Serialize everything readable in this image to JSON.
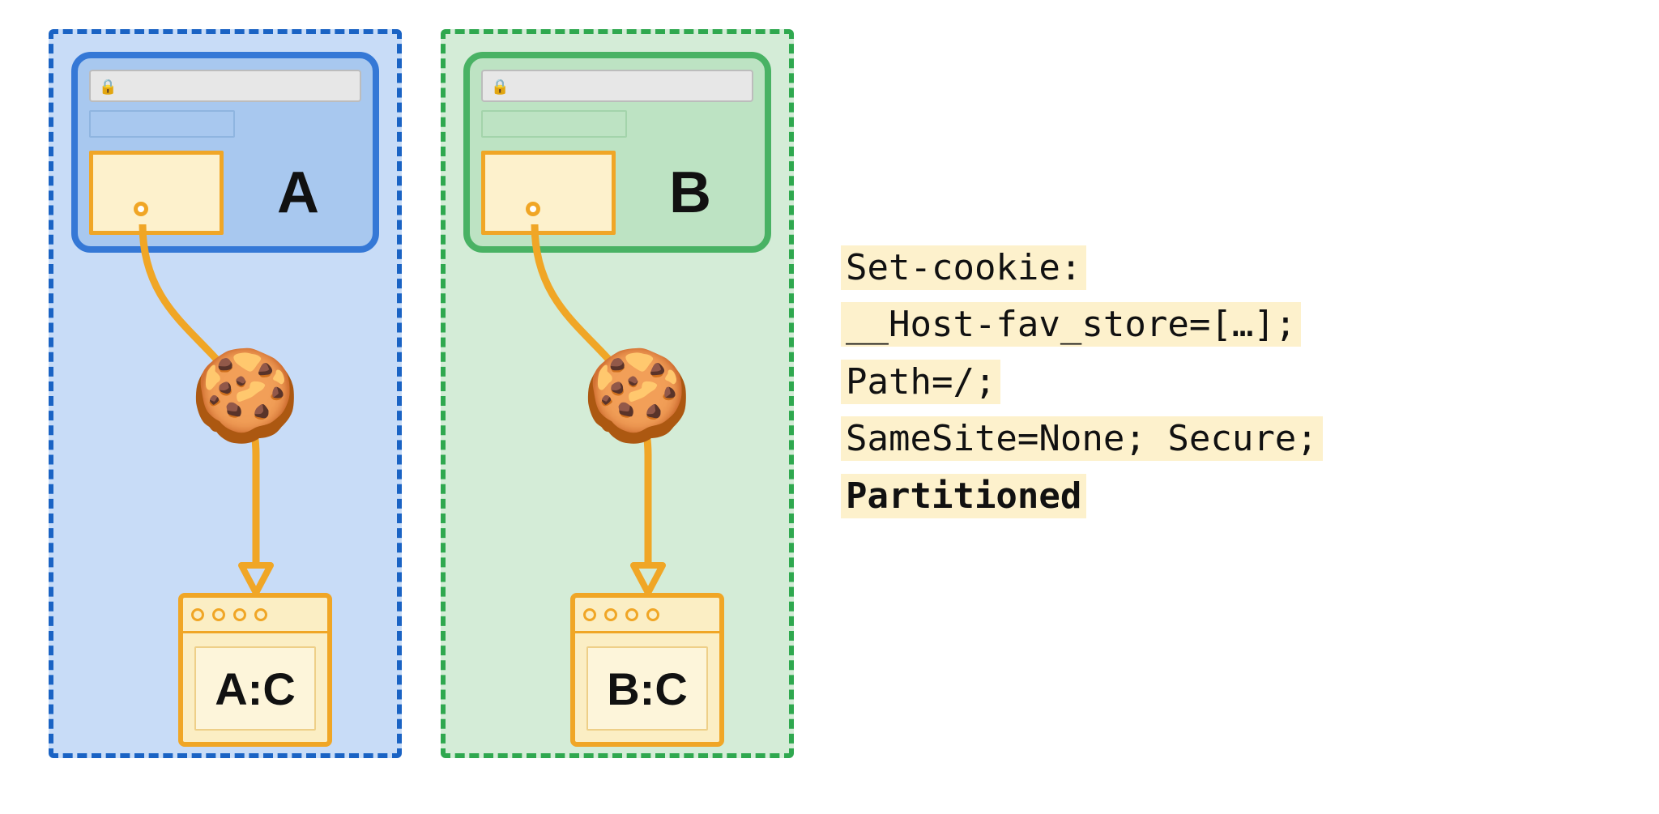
{
  "partitionA": {
    "site_label": "A",
    "storage_label": "A:C"
  },
  "partitionB": {
    "site_label": "B",
    "storage_label": "B:C"
  },
  "code": {
    "line1": "Set-cookie:",
    "line2": "__Host-fav_store=[…];",
    "line3": "Path=/;",
    "line4": "SameSite=None; Secure;",
    "line5": "Partitioned"
  },
  "icons": {
    "cookie": "🍪",
    "lock": "🔒"
  },
  "colors": {
    "blue_stroke": "#1a63c4",
    "blue_fill": "#c8dcf7",
    "green_stroke": "#2fa84f",
    "green_fill": "#d4ecd7",
    "orange": "#f0a626",
    "highlight": "#fdf1cc"
  }
}
